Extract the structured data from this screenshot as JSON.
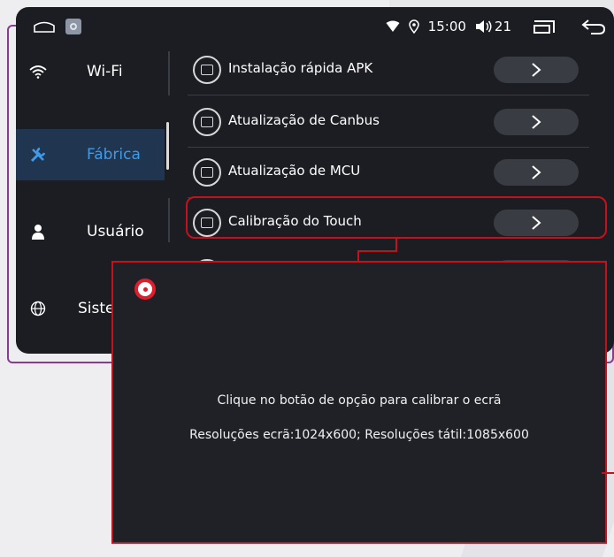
{
  "status_bar": {
    "time": "15:00",
    "volume": "21"
  },
  "nav": {
    "items": [
      {
        "label": "Wi-Fi",
        "icon": "wifi-icon"
      },
      {
        "label": "Fábrica",
        "icon": "wrench-icon",
        "active": true
      },
      {
        "label": "Usuário",
        "icon": "user-icon"
      },
      {
        "label": "Siste",
        "icon": "globe-icon"
      }
    ]
  },
  "list": {
    "items": [
      {
        "label": "Instalação rápida APK",
        "icon": "apk-icon"
      },
      {
        "label": "Atualização de Canbus",
        "icon": "canbus-icon"
      },
      {
        "label": "Atualização de MCU",
        "icon": "mcu-icon"
      },
      {
        "label": "Calibração do Touch",
        "icon": "touch-icon",
        "highlighted": true
      }
    ]
  },
  "popup": {
    "line1": "Clique no botão de opção para calibrar o ecrã",
    "line2": "Resoluções ecrã:1024x600; Resoluções tátil:1085x600"
  },
  "colors": {
    "accent": "#3e9bea",
    "highlight": "#c2121e",
    "frame": "#8a3a94"
  }
}
